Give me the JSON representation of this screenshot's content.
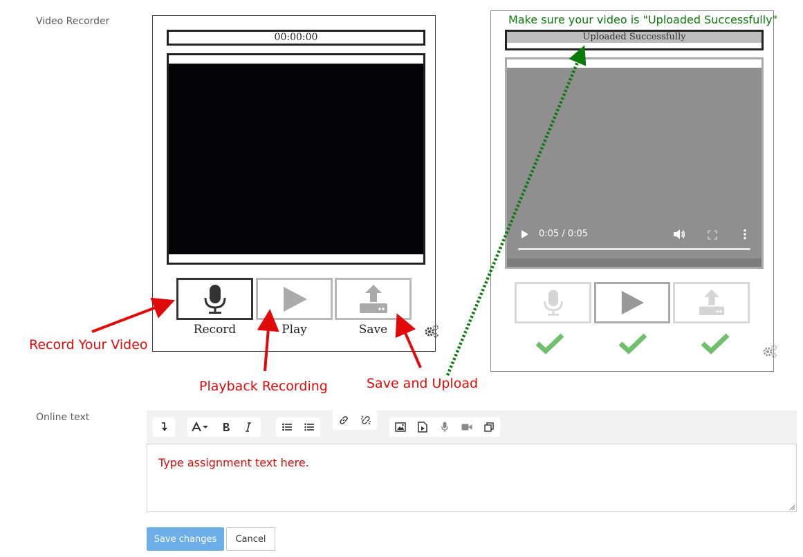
{
  "form": {
    "video_recorder_label": "Video Recorder",
    "online_text_label": "Online text"
  },
  "recorder": {
    "timer": "00:00:00",
    "buttons": [
      {
        "label": "Record",
        "icon": "microphone-icon"
      },
      {
        "label": "Play",
        "icon": "play-icon"
      },
      {
        "label": "Save",
        "icon": "upload-icon"
      }
    ]
  },
  "preview": {
    "status": "Uploaded Successfully",
    "time": "0:05 / 0:05"
  },
  "annotations": {
    "record": "Record Your Video",
    "playback": "Playback Recording",
    "save_upload": "Save and Upload",
    "make_sure": "Make sure your video is \"Uploaded Successfully\""
  },
  "editor": {
    "placeholder_text": "Type assignment text here."
  },
  "actions": {
    "save": "Save changes",
    "cancel": "Cancel"
  },
  "colors": {
    "annotation_red": "#e00a0a",
    "annotation_green": "#0a7a0a",
    "primary_button": "#6eaee8",
    "check_green": "#6fbf6f"
  }
}
